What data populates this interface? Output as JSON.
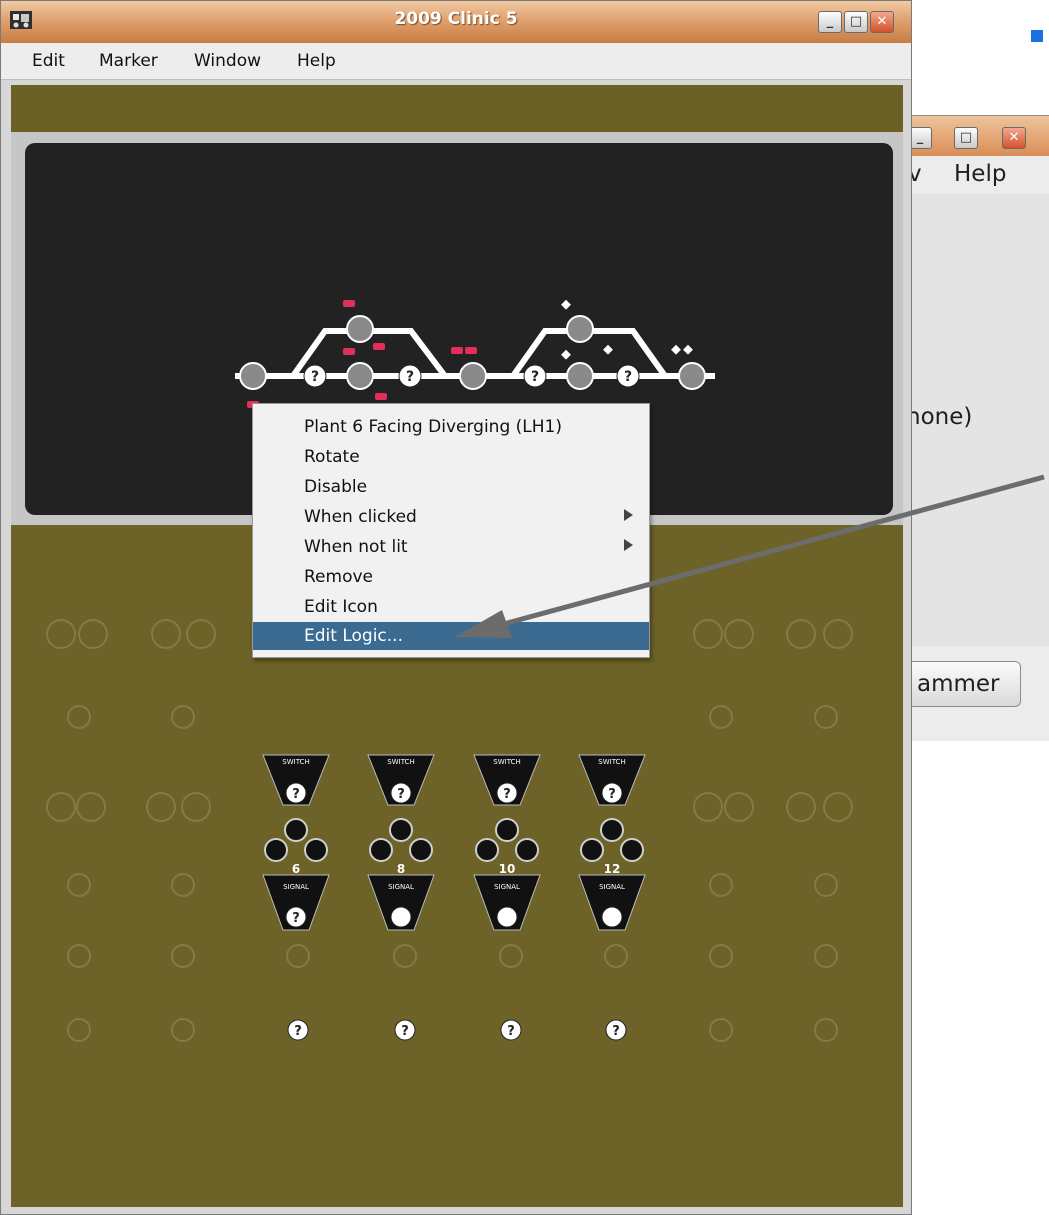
{
  "window": {
    "title": "2009 Clinic 5"
  },
  "menubar": {
    "items": [
      "Edit",
      "Marker",
      "Window",
      "Help"
    ]
  },
  "window_controls": {
    "minimize": "_",
    "maximize": "□",
    "close": "✕"
  },
  "background_window": {
    "menu_partial": "v",
    "menu_help": "Help",
    "text_partial": "none)",
    "button_partial": "ammer"
  },
  "context_menu": {
    "items": [
      {
        "label": "Plant 6 Facing Diverging (LH1)",
        "submenu": false
      },
      {
        "label": "Rotate",
        "submenu": false
      },
      {
        "label": "Disable",
        "submenu": false
      },
      {
        "label": "When clicked",
        "submenu": true
      },
      {
        "label": "When not lit",
        "submenu": true
      },
      {
        "label": "Remove",
        "submenu": false
      },
      {
        "label": "Edit Icon",
        "submenu": false
      },
      {
        "label": "Edit Logic...",
        "submenu": false,
        "selected": true
      }
    ]
  },
  "panel": {
    "switch_label": "SWITCH",
    "signal_label": "SIGNAL",
    "signal_numbers": [
      "6",
      "8",
      "10",
      "12"
    ],
    "unknown_glyph": "?"
  },
  "colors": {
    "titlebar": "#d98e56",
    "menu_selection": "#3b6b90",
    "panel": "#6e6328",
    "track_bg": "#222222",
    "marker_blue": "#1c6fe0"
  }
}
